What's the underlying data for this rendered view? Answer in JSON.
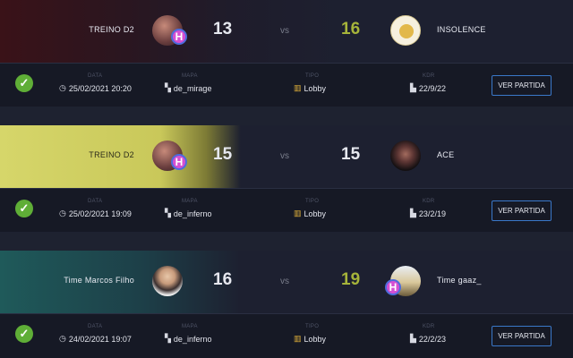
{
  "labels": {
    "data": "DATA",
    "mapa": "MAPA",
    "tipo": "TIPO",
    "kdr": "KDR",
    "vs": "vs",
    "button": "VER PARTIDA"
  },
  "matches": [
    {
      "team_left": "TREINO D2",
      "score_left": "13",
      "score_right": "16",
      "team_right": "INSOLENCE",
      "winner": "right",
      "date": "25/02/2021 20:20",
      "map": "de_mirage",
      "type": "Lobby",
      "kdr": "22/9/22",
      "left_avatar_icon": "team-avatar",
      "right_avatar_icon": "insolence-logo"
    },
    {
      "team_left": "TREINO D2",
      "score_left": "15",
      "score_right": "15",
      "team_right": "ACE",
      "winner": "none",
      "date": "25/02/2021 19:09",
      "map": "de_inferno",
      "type": "Lobby",
      "kdr": "23/2/19",
      "left_avatar_icon": "team-avatar",
      "right_avatar_icon": "player-avatar"
    },
    {
      "team_left": "Time Marcos Filho",
      "score_left": "16",
      "score_right": "19",
      "team_right": "Time gaaz_",
      "winner": "right",
      "date": "24/02/2021 19:07",
      "map": "de_inferno",
      "type": "Lobby",
      "kdr": "22/2/23",
      "left_avatar_icon": "player-avatar",
      "right_avatar_icon": "team-avatar"
    }
  ],
  "colors": {
    "background": "#1a1d2b",
    "win_score": "#a6b43a",
    "button_border": "#3a78c9",
    "check": "#5fae37"
  }
}
